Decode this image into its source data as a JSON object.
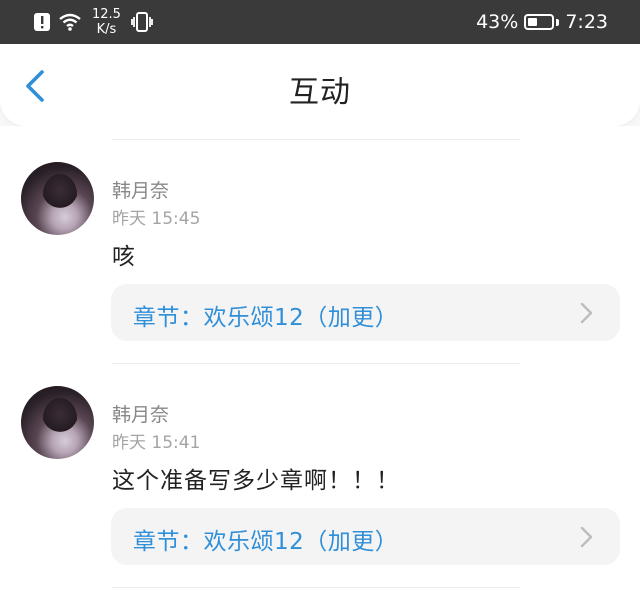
{
  "status_bar": {
    "net_speed_value": "12.5",
    "net_speed_unit": "K/s",
    "battery_percent": "43%",
    "battery_level": 0.43,
    "time": "7:23",
    "icons": [
      "alert-icon",
      "wifi-icon",
      "vibrate-icon",
      "battery-icon"
    ]
  },
  "header": {
    "title": "互动",
    "back_icon": "chevron-left-icon"
  },
  "colors": {
    "accent": "#2f8fd8",
    "status_bar_bg": "#3a3a3a"
  },
  "interactions": [
    {
      "username": "韩月奈",
      "time": "昨天 15:45",
      "comment": "咳",
      "chapter": "章节：欢乐颂12（加更）"
    },
    {
      "username": "韩月奈",
      "time": "昨天 15:41",
      "comment": "这个准备写多少章啊！！！",
      "chapter": "章节：欢乐颂12（加更）"
    }
  ]
}
